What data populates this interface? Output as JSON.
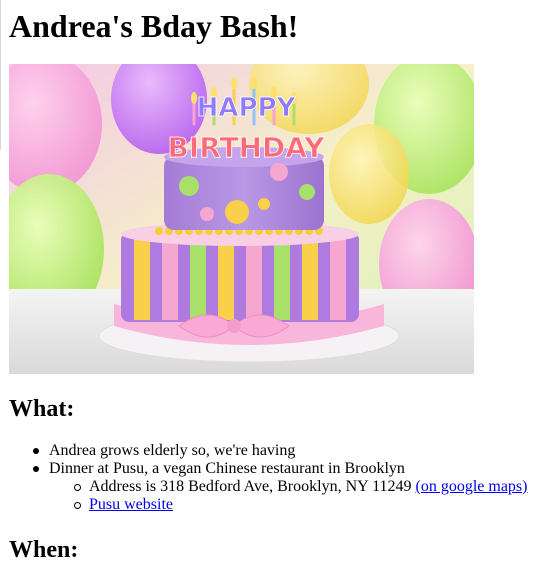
{
  "page": {
    "title": "Andrea's Bday Bash!"
  },
  "hero": {
    "cake_text_top": "HAPPY",
    "cake_text_bottom": "BIRTHDAY"
  },
  "what": {
    "heading": "What:",
    "items": [
      "Andrea grows elderly so, we're having",
      "Dinner at Pusu, a vegan Chinese restaurant in Brooklyn"
    ],
    "sub_items": {
      "address_text": "Address is 318 Bedford Ave, Brooklyn, NY 11249",
      "maps_link": "(on google maps)",
      "website_link": "Pusu website"
    }
  },
  "when": {
    "heading": "When:"
  },
  "colors": {
    "link": "#0000ee",
    "text": "#000000",
    "background": "#ffffff"
  }
}
